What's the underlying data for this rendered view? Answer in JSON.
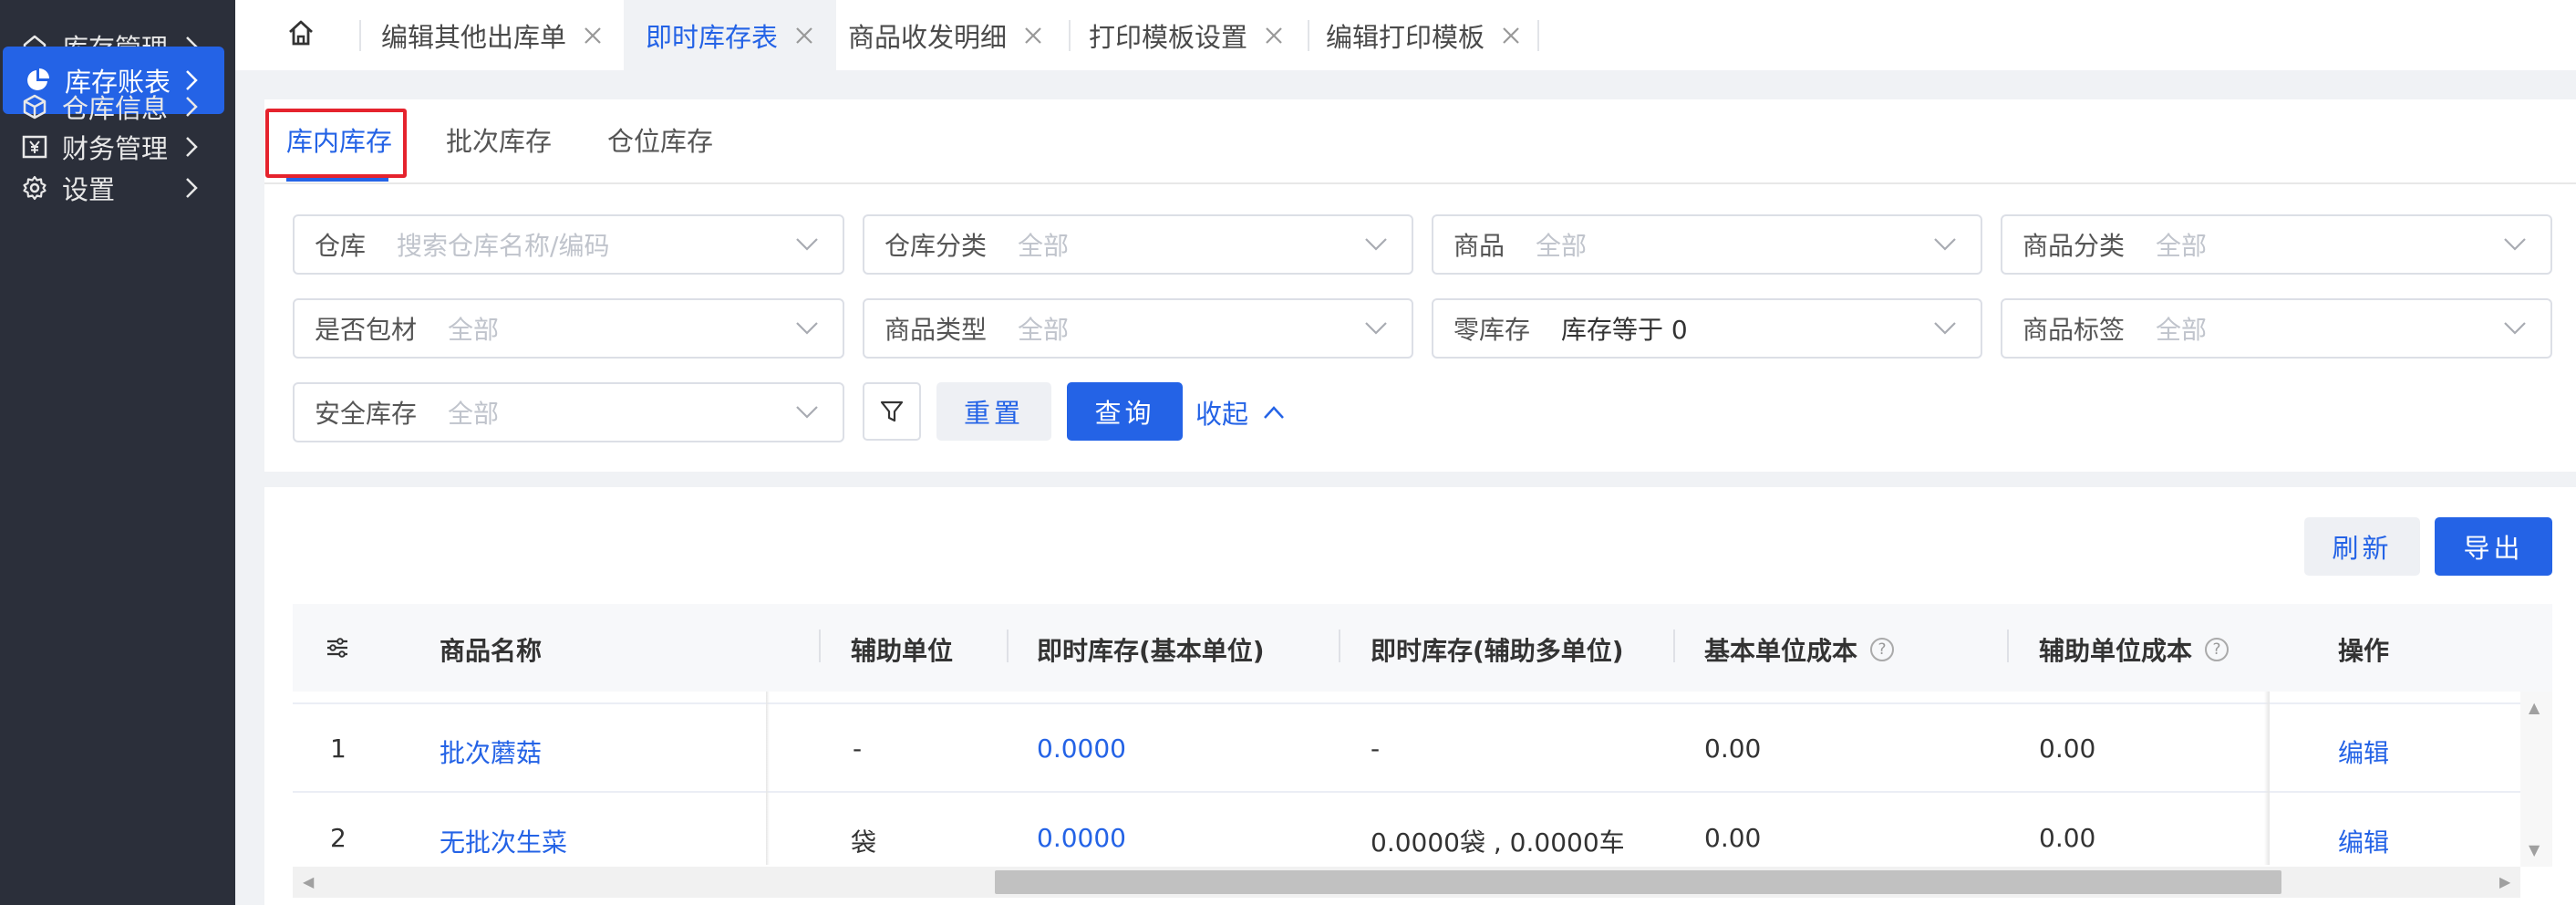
{
  "sidebar": {
    "items": [
      {
        "label": "库存管理",
        "icon": "home-icon"
      },
      {
        "label": "库存账表",
        "icon": "pie-chart-icon"
      },
      {
        "label": "仓库信息",
        "icon": "box-icon"
      },
      {
        "label": "财务管理",
        "icon": "yen-icon"
      },
      {
        "label": "设置",
        "icon": "gear-icon"
      }
    ]
  },
  "tabs": [
    {
      "label": "编辑其他出库单"
    },
    {
      "label": "即时库存表"
    },
    {
      "label": "商品收发明细"
    },
    {
      "label": "打印模板设置"
    },
    {
      "label": "编辑打印模板"
    }
  ],
  "subtabs": [
    "库内库存",
    "批次库存",
    "仓位库存"
  ],
  "filters": [
    {
      "label": "仓库",
      "value": "搜索仓库名称/编码"
    },
    {
      "label": "仓库分类",
      "value": "全部"
    },
    {
      "label": "商品",
      "value": "全部"
    },
    {
      "label": "商品分类",
      "value": "全部"
    },
    {
      "label": "是否包材",
      "value": "全部"
    },
    {
      "label": "商品类型",
      "value": "全部"
    },
    {
      "label": "零库存",
      "value": "库存等于 0"
    },
    {
      "label": "商品标签",
      "value": "全部"
    },
    {
      "label": "安全库存",
      "value": "全部"
    }
  ],
  "actions": {
    "reset": "重置",
    "query": "查询",
    "collapse": "收起",
    "refresh": "刷新",
    "export": "导出"
  },
  "table": {
    "columns": [
      "商品名称",
      "辅助单位",
      "即时库存(基本单位)",
      "即时库存(辅助多单位)",
      "基本单位成本",
      "辅助单位成本",
      "操作"
    ],
    "rows": [
      {
        "index": "1",
        "name": "批次蘑菇",
        "aux_unit": "-",
        "stock_base": "0.0000",
        "stock_aux": "-",
        "cost_base": "0.00",
        "cost_aux": "0.00",
        "op": "编辑"
      },
      {
        "index": "2",
        "name": "无批次生菜",
        "aux_unit": "袋",
        "stock_base": "0.0000",
        "stock_aux": "0.0000袋 , 0.0000车",
        "cost_base": "0.00",
        "cost_aux": "0.00",
        "op": "编辑"
      }
    ]
  },
  "colors": {
    "accent": "#2463e6",
    "sidebar_bg": "#2b2f3a",
    "highlight_box": "#e5232d"
  }
}
